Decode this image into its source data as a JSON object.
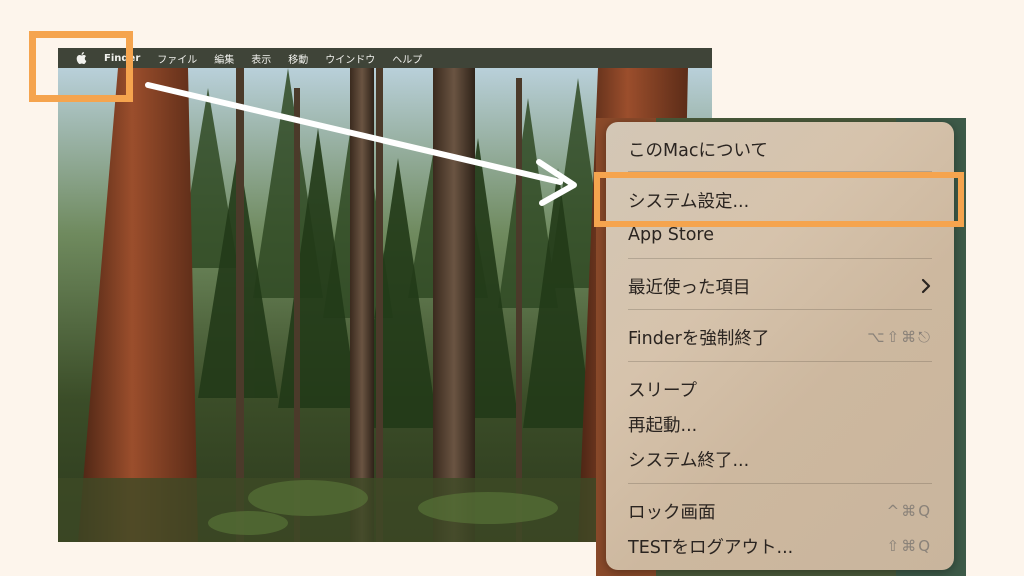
{
  "menubar": {
    "apple_icon": "apple-logo-icon",
    "items": [
      "Finder",
      "ファイル",
      "編集",
      "表示",
      "移動",
      "ウインドウ",
      "ヘルプ"
    ]
  },
  "apple_menu": {
    "items": [
      {
        "label": "このMacについて",
        "shortcut": ""
      },
      {
        "label": "システム設定...",
        "shortcut": ""
      },
      {
        "label": "App Store",
        "shortcut": ""
      },
      {
        "label": "最近使った項目",
        "shortcut": ""
      },
      {
        "label": "Finderを強制終了",
        "shortcut": "⌥⇧⌘⎋"
      },
      {
        "label": "スリープ",
        "shortcut": ""
      },
      {
        "label": "再起動...",
        "shortcut": ""
      },
      {
        "label": "システム終了...",
        "shortcut": ""
      },
      {
        "label": "ロック画面",
        "shortcut": "^⌘Q"
      },
      {
        "label": "TESTをログアウト...",
        "shortcut": "⇧⌘Q"
      }
    ],
    "submenu_icon": "chevron-right-icon"
  },
  "colors": {
    "highlight": "#f5a44e",
    "arrow": "#ffffff",
    "background": "#fdf5ec"
  }
}
